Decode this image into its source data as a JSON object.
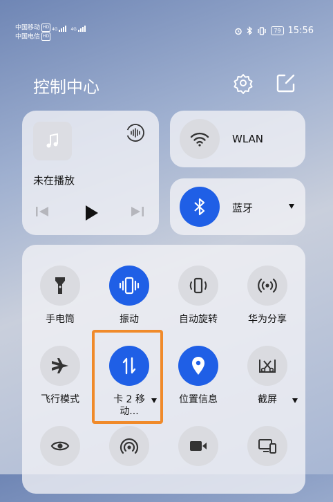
{
  "status_bar": {
    "carrier1": "中国移动",
    "carrier2": "中国电信",
    "hd": "HD",
    "net1": "4G",
    "net2": "4G",
    "battery": "79",
    "time": "15:56"
  },
  "header": {
    "title": "控制中心",
    "settings_icon": "gear-icon",
    "edit_icon": "edit-icon"
  },
  "media": {
    "status": "未在播放"
  },
  "wlan": {
    "label": "WLAN"
  },
  "bluetooth": {
    "label": "蓝牙"
  },
  "tiles": [
    {
      "label": "手电筒",
      "active": false,
      "icon": "flashlight-icon"
    },
    {
      "label": "振动",
      "active": true,
      "icon": "vibrate-icon"
    },
    {
      "label": "自动旋转",
      "active": false,
      "icon": "rotate-icon"
    },
    {
      "label": "华为分享",
      "active": false,
      "icon": "share-icon"
    },
    {
      "label": "飞行模式",
      "active": false,
      "icon": "airplane-icon"
    },
    {
      "label": "卡 2 移动...",
      "active": true,
      "icon": "mobile-data-icon"
    },
    {
      "label": "位置信息",
      "active": true,
      "icon": "location-icon"
    },
    {
      "label": "截屏",
      "active": false,
      "icon": "screenshot-icon"
    },
    {
      "label": "",
      "active": false,
      "icon": "eye-icon"
    },
    {
      "label": "",
      "active": false,
      "icon": "hotspot-icon"
    },
    {
      "label": "",
      "active": false,
      "icon": "screen-record-icon"
    },
    {
      "label": "",
      "active": false,
      "icon": "multi-screen-icon"
    }
  ],
  "colors": {
    "accent": "#1f5fe6",
    "highlight": "#f08a2a",
    "tile_off": "#dadbe0"
  }
}
